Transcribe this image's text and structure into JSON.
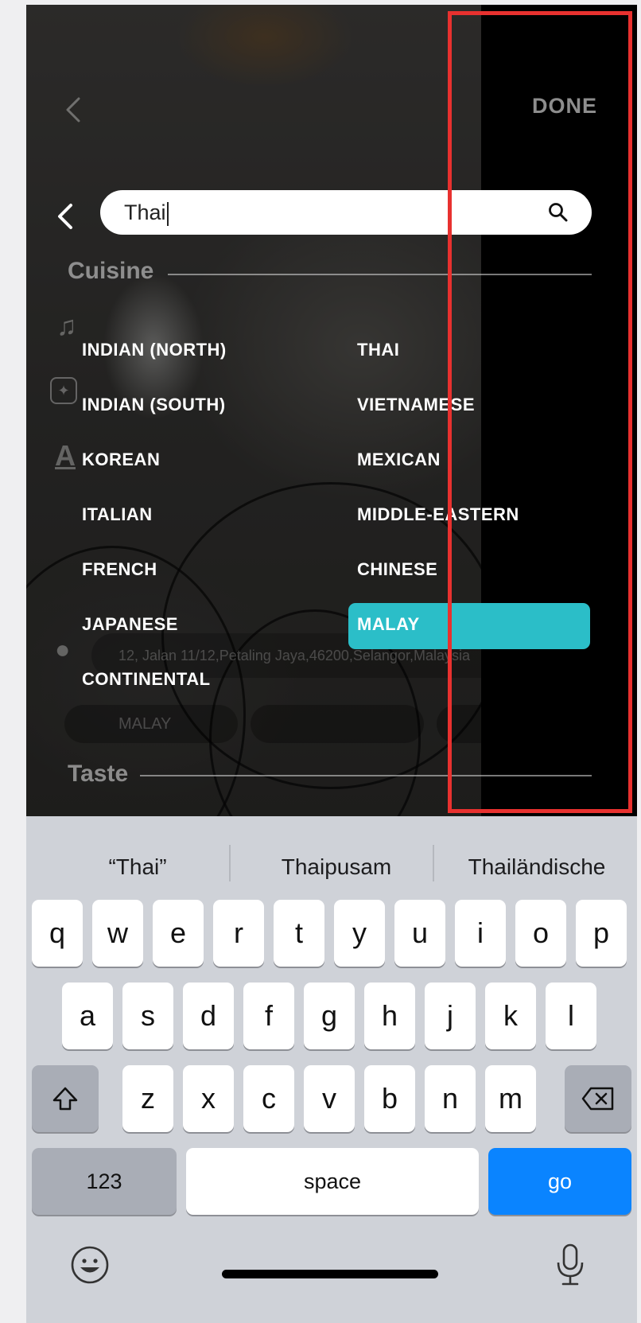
{
  "nav": {
    "done_label": "DONE"
  },
  "search": {
    "value": "Thai"
  },
  "sections": {
    "cuisine": "Cuisine",
    "taste": "Taste"
  },
  "cuisine": {
    "left": [
      "INDIAN (NORTH)",
      "INDIAN (SOUTH)",
      "KOREAN",
      "ITALIAN",
      "FRENCH",
      "JAPANESE",
      "CONTINENTAL"
    ],
    "right": [
      "THAI",
      "VIETNAMESE",
      "MEXICAN",
      "MIDDLE-EASTERN",
      "CHINESE",
      "MALAY"
    ],
    "selected": "MALAY"
  },
  "background": {
    "address": "12, Jalan 11/12,Petaling Jaya,46200,Selangor,Malaysia",
    "chip": "MALAY"
  },
  "keyboard": {
    "suggestions": [
      "“Thai”",
      "Thaipusam",
      "Thailändische"
    ],
    "row1": [
      "q",
      "w",
      "e",
      "r",
      "t",
      "y",
      "u",
      "i",
      "o",
      "p"
    ],
    "row2": [
      "a",
      "s",
      "d",
      "f",
      "g",
      "h",
      "j",
      "k",
      "l"
    ],
    "row3": [
      "z",
      "x",
      "c",
      "v",
      "b",
      "n",
      "m"
    ],
    "numbers_label": "123",
    "space_label": "space",
    "go_label": "go"
  },
  "colors": {
    "selected": "#2bbec8",
    "go_key": "#0a84ff",
    "highlight": "#e8312f"
  }
}
